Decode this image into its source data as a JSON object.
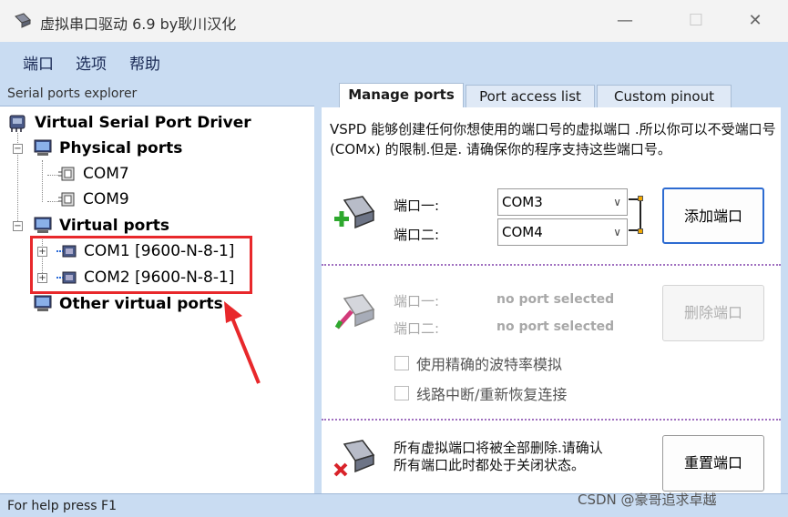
{
  "window": {
    "title": "虚拟串口驱动 6.9 by耿川汉化"
  },
  "menu": {
    "items": [
      "端口",
      "选项",
      "帮助"
    ]
  },
  "explorer": {
    "header": "Serial ports explorer",
    "root": "Virtual Serial Port Driver",
    "physical_label": "Physical ports",
    "physical_ports": [
      "COM7",
      "COM9"
    ],
    "virtual_label": "Virtual ports",
    "virtual_ports": [
      "COM1 [9600-N-8-1]",
      "COM2 [9600-N-8-1]"
    ],
    "other_label": "Other virtual ports"
  },
  "tabs": [
    "Manage ports",
    "Port access list",
    "Custom pinout"
  ],
  "manage": {
    "description": "VSPD 能够创建任何你想使用的端口号的虚拟端口 .所以你可以不受端口号(COMx) 的限制.但是. 请确保你的程序支持这些端口号。",
    "add": {
      "port1_label": "端口一:",
      "port2_label": "端口二:",
      "port1_value": "COM3",
      "port2_value": "COM4",
      "button": "添加端口"
    },
    "remove": {
      "port1_label": "端口一:",
      "port2_label": "端口二:",
      "port1_value": "no port selected",
      "port2_value": "no port selected",
      "button": "删除端口",
      "option1": "使用精确的波特率模拟",
      "option2": "线路中断/重新恢复连接"
    },
    "reset": {
      "text": "所有虚拟端口将被全部删除.请确认所有端口此时都处于关闭状态。",
      "button": "重置端口"
    }
  },
  "status": {
    "text": "For help press F1"
  },
  "watermark": "CSDN @豪哥追求卓越",
  "colors": {
    "panel_bg": "#c9dcf2",
    "highlight": "#e8282b",
    "accent_border": "#2d6bd1"
  }
}
